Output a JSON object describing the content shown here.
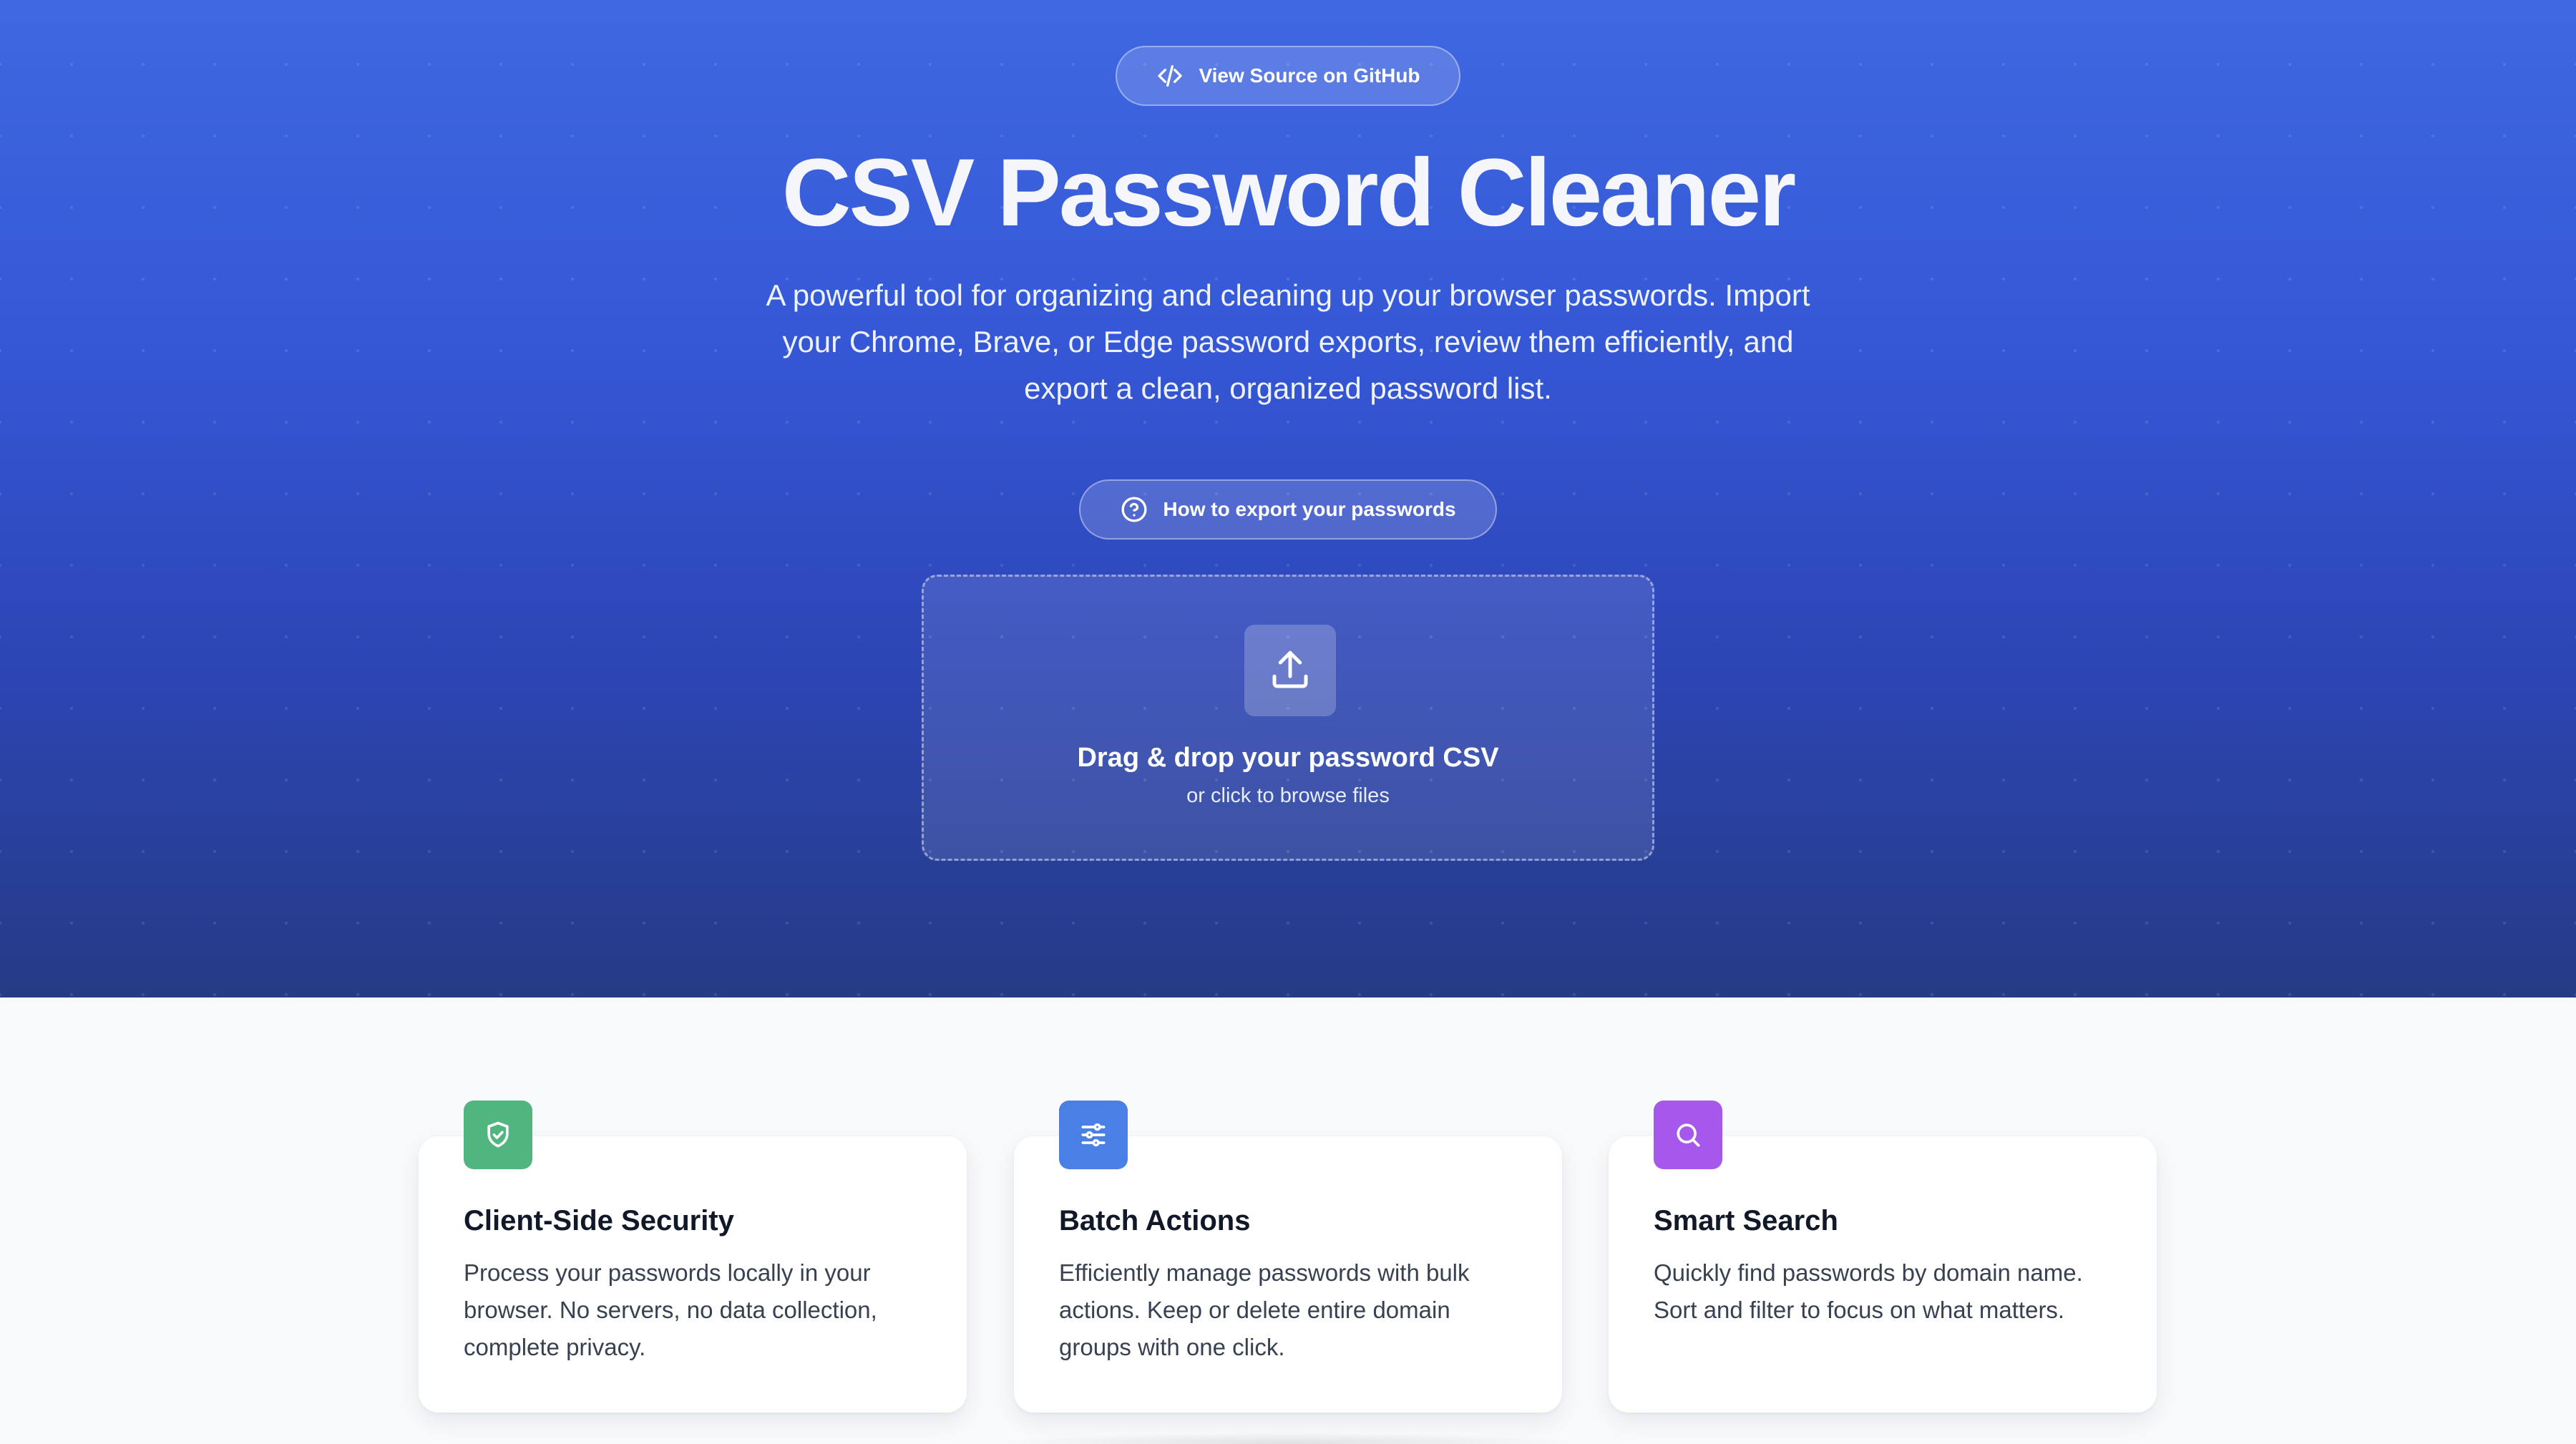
{
  "header": {
    "github_label": "View Source on GitHub",
    "title": "CSV Password Cleaner",
    "description": "A powerful tool for organizing and cleaning up your browser passwords. Import your Chrome, Brave, or Edge password exports, review them efficiently, and export a clean, organized password list.",
    "help_label": "How to export your passwords"
  },
  "dropzone": {
    "title": "Drag & drop your password CSV",
    "subtitle": "or click to browse files"
  },
  "features": [
    {
      "icon": "shield-check-icon",
      "color": "#51b57f",
      "title": "Client-Side Security",
      "text": "Process your passwords locally in your browser. No servers, no data collection, complete privacy."
    },
    {
      "icon": "sliders-icon",
      "color": "#4a7fe6",
      "title": "Batch Actions",
      "text": "Efficiently manage passwords with bulk actions. Keep or delete entire domain groups with one click."
    },
    {
      "icon": "search-icon",
      "color": "#a658ec",
      "title": "Smart Search",
      "text": "Quickly find passwords by domain name. Sort and filter to focus on what matters."
    }
  ],
  "colors": {
    "hero_top": "#3f68e1",
    "hero_bottom": "#253b85",
    "page_background": "#f8fafc"
  }
}
